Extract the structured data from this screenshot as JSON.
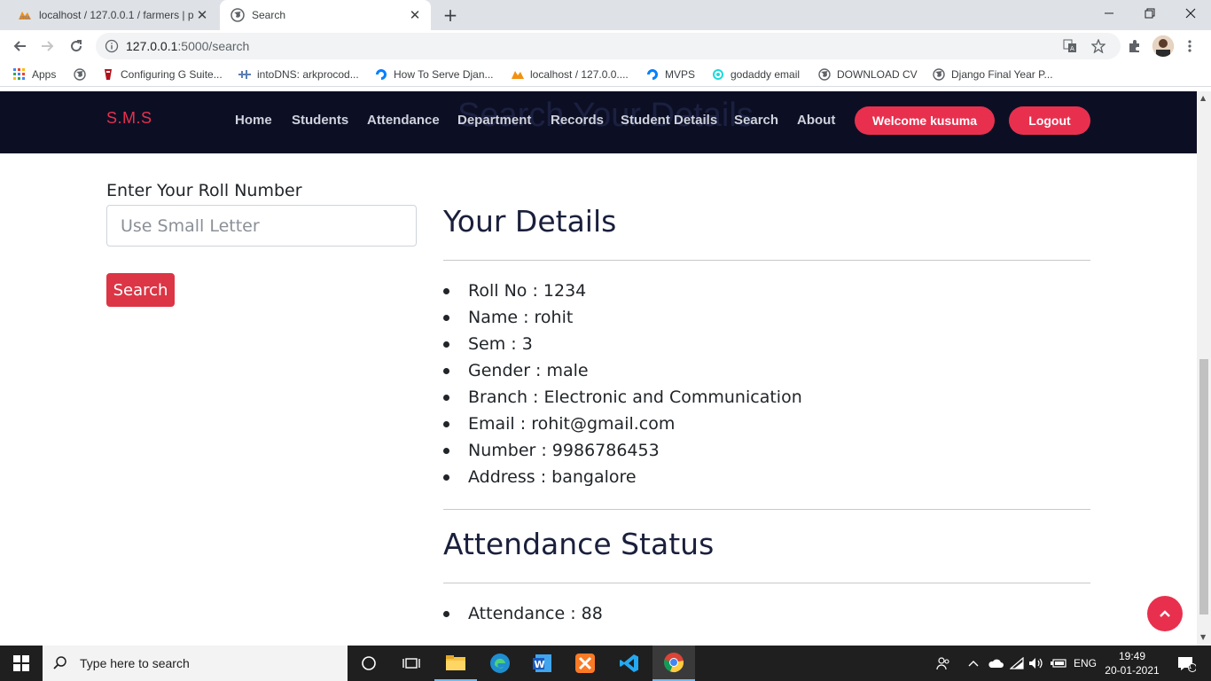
{
  "browser": {
    "tabs": [
      {
        "title": "localhost / 127.0.0.1 / farmers | p"
      },
      {
        "title": "Search"
      }
    ],
    "url": {
      "host": "127.0.0.1",
      "path": ":5000/search"
    },
    "bookmarks": [
      {
        "label": "Apps",
        "icon": "apps-grid-icon"
      },
      {
        "label": "",
        "icon": "globe-icon"
      },
      {
        "label": "Configuring G Suite...",
        "icon": "page-icon"
      },
      {
        "label": "intoDNS: arkprocod...",
        "icon": "dns-icon"
      },
      {
        "label": "How To Serve Djan...",
        "icon": "digitalocean-icon"
      },
      {
        "label": "localhost / 127.0.0....",
        "icon": "phpmyadmin-icon"
      },
      {
        "label": "MVPS",
        "icon": "digitalocean-icon"
      },
      {
        "label": "godaddy email",
        "icon": "godaddy-icon"
      },
      {
        "label": "DOWNLOAD CV",
        "icon": "globe-icon"
      },
      {
        "label": "Django Final Year P...",
        "icon": "globe-icon"
      }
    ]
  },
  "site": {
    "brand": "S.M.S",
    "ghost_title": "Search Your Details",
    "nav": [
      "Home",
      "Students",
      "Attendance",
      "Department",
      "Records",
      "Student Details",
      "Search",
      "About"
    ],
    "welcome": "Welcome kusuma",
    "logout": "Logout"
  },
  "search": {
    "label": "Enter Your Roll Number",
    "placeholder": "Use Small Letter",
    "button": "Search"
  },
  "details": {
    "heading": "Your Details",
    "items": [
      "Roll No : 1234",
      "Name : rohit",
      "Sem : 3",
      "Gender : male",
      "Branch : Electronic and Communication",
      "Email : rohit@gmail.com",
      "Number : 9986786453",
      "Address : bangalore"
    ]
  },
  "attendance": {
    "heading": "Attendance Status",
    "items": [
      "Attendance : 88"
    ]
  },
  "taskbar": {
    "search_placeholder": "Type here to search",
    "language": "ENG",
    "time": "19:49",
    "date": "20-01-2021",
    "notification_count": "1"
  },
  "colors": {
    "accent": "#e8304e",
    "nav_bg": "#0c0f24",
    "search_button": "#dc3545"
  }
}
